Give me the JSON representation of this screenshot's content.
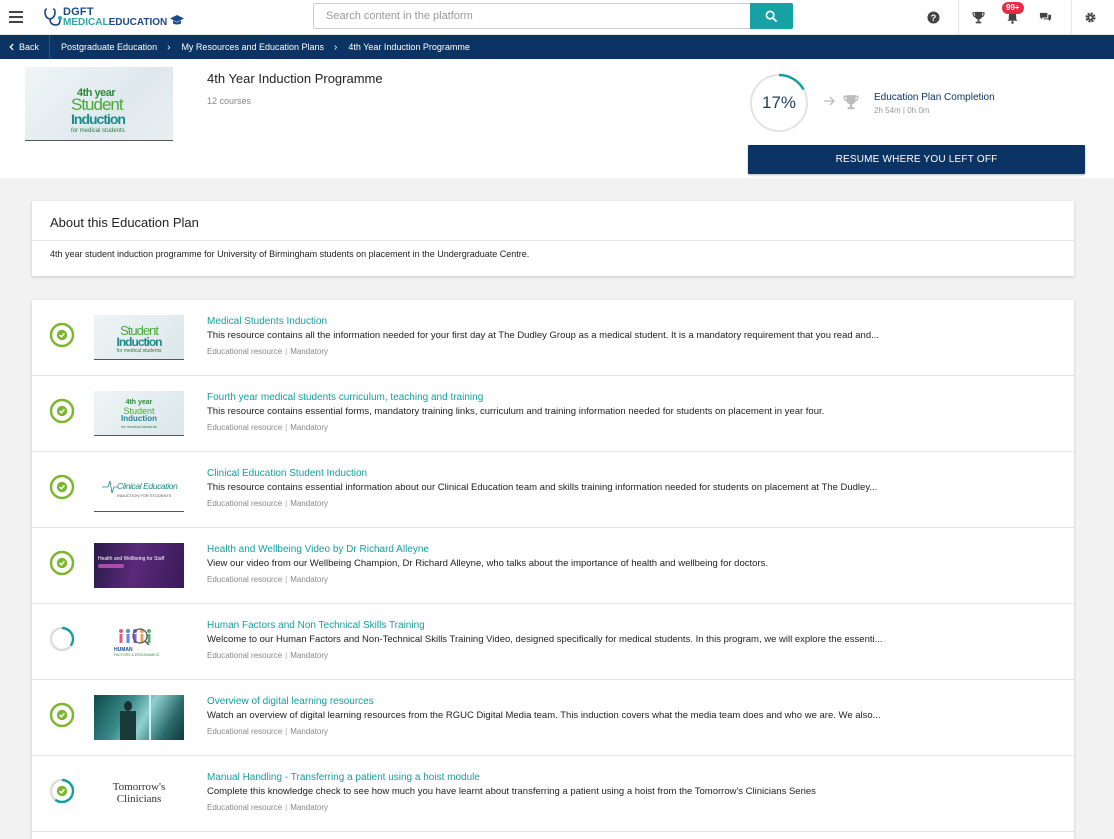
{
  "app": {
    "logo_top": "DGFT",
    "logo_bottom_1": "MEDICAL",
    "logo_bottom_2": "EDUCATION",
    "search_placeholder": "Search content in the platform",
    "notification_count": "99+"
  },
  "breadcrumb": {
    "back_label": "Back",
    "items": [
      "Postgraduate Education",
      "My Resources and Education Plans",
      "4th Year Induction Programme"
    ]
  },
  "plan": {
    "hero_line1": "4th year",
    "hero_line2": "Student",
    "hero_line3": "Induction",
    "hero_line4": "for medical students",
    "title": "4th Year Induction Programme",
    "course_count": "12 courses",
    "progress_label": "17%",
    "progress_value": 0.17,
    "completion_title": "Education Plan Completion",
    "completion_time": "2h 54m | 0h 0m",
    "resume_label": "RESUME WHERE YOU LEFT OFF"
  },
  "about": {
    "heading": "About this Education Plan",
    "text": "4th year student induction programme for University of Birmingham students on placement in the Undergraduate Centre."
  },
  "courses": [
    {
      "title": "Medical Students Induction",
      "description": "This resource contains all the information needed for your first day at The Dudley Group as a medical student. It is a mandatory requirement that you read and...",
      "type": "Educational resource",
      "tag": "Mandatory",
      "status": "complete",
      "progress": 1,
      "thumb_line1": "Student",
      "thumb_line2": "Induction",
      "thumb_line3": "for medical students"
    },
    {
      "title": "Fourth year medical students curriculum, teaching and training",
      "description": "This resource contains essential forms, mandatory training links, curriculum and training information needed for students on placement in year four.",
      "type": "Educational resource",
      "tag": "Mandatory",
      "status": "complete",
      "progress": 1,
      "thumb_line1": "4th year",
      "thumb_line2": "Student",
      "thumb_line3": "Induction",
      "thumb_line4": "for medical students"
    },
    {
      "title": "Clinical Education Student Induction",
      "description": "This resource contains essential information about our Clinical Education team and skills training information needed for students on placement at The Dudley...",
      "type": "Educational resource",
      "tag": "Mandatory",
      "status": "complete",
      "progress": 1,
      "thumb_line1": "Clinical Education",
      "thumb_line2": "INDUCTION FOR STUDENTS"
    },
    {
      "title": "Health and Wellbeing Video by Dr Richard Alleyne",
      "description": "View our video from our Wellbeing Champion, Dr Richard Alleyne, who talks about the importance of health and wellbeing for doctors.",
      "type": "Educational resource",
      "tag": "Mandatory",
      "status": "complete",
      "progress": 1,
      "thumb_line1": "Health and Wellbeing for Staff"
    },
    {
      "title": "Human Factors and Non Technical Skills Training",
      "description": "Welcome to our Human Factors and Non-Technical Skills Training Video, designed specifically for medical students. In this program, we will explore the essenti...",
      "type": "Educational resource",
      "tag": "Mandatory",
      "status": "in-progress",
      "progress": 0.35,
      "thumb_line1": "HUMAN",
      "thumb_line2": "FACTORS & ERGONOMICS"
    },
    {
      "title": "Overview of digital learning resources",
      "description": "Watch an overview of digital learning resources from the RGUC Digital Media team. This induction covers what the media team does and who we are. We also...",
      "type": "Educational resource",
      "tag": "Mandatory",
      "status": "complete",
      "progress": 1
    },
    {
      "title": "Manual Handling - Transferring a patient using a hoist module",
      "description": "Complete this knowledge check to see how much you have learnt about transferring a patient using a hoist from the Tomorrow's Clinicians Series",
      "type": "Educational resource",
      "tag": "Mandatory",
      "status": "in-progress",
      "progress": 0.6,
      "thumb_line1": "Tomorrow's",
      "thumb_line2": "Clinicians"
    }
  ],
  "colors": {
    "navy": "#0b3464",
    "teal": "#14a0a0",
    "check_green": "#7cb82f",
    "badge_red": "#e62b47"
  }
}
